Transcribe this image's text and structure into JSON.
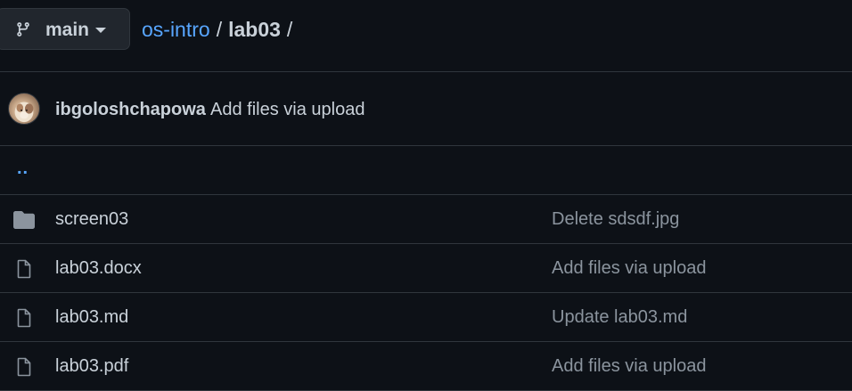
{
  "branch": {
    "label": "main",
    "icon": "git-branch-icon"
  },
  "breadcrumb": {
    "repo": "os-intro",
    "separator": "/",
    "current": "lab03",
    "trailing": "/"
  },
  "latest_commit": {
    "author": "ibgoloshchapowa",
    "message": "Add files via upload"
  },
  "parent_link": "..",
  "files": [
    {
      "type": "directory",
      "icon": "folder-icon",
      "name": "screen03",
      "commit": "Delete sdsdf.jpg"
    },
    {
      "type": "file",
      "icon": "file-icon",
      "name": "lab03.docx",
      "commit": "Add files via upload"
    },
    {
      "type": "file",
      "icon": "file-icon",
      "name": "lab03.md",
      "commit": "Update lab03.md"
    },
    {
      "type": "file",
      "icon": "file-icon",
      "name": "lab03.pdf",
      "commit": "Add files via upload"
    }
  ],
  "colors": {
    "background": "#0d1117",
    "border": "#30363d",
    "link": "#58a6ff",
    "text": "#c9d1d9",
    "muted": "#8b949e",
    "icon": "#8b949e"
  }
}
